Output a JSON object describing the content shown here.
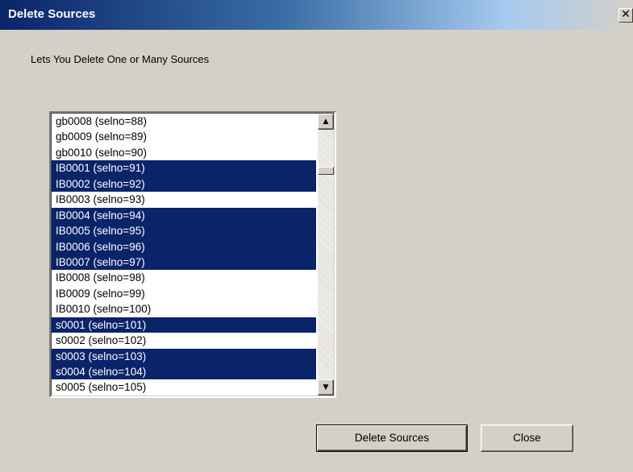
{
  "window": {
    "title": "Delete Sources",
    "close_glyph": "✕"
  },
  "description": "Lets You Delete One or Many Sources",
  "sources_list": {
    "items": [
      {
        "label": "gb0008 (selno=88)",
        "selected": false
      },
      {
        "label": "gb0009 (selno=89)",
        "selected": false
      },
      {
        "label": "gb0010 (selno=90)",
        "selected": false
      },
      {
        "label": "IB0001 (selno=91)",
        "selected": true
      },
      {
        "label": "IB0002 (selno=92)",
        "selected": true
      },
      {
        "label": "IB0003 (selno=93)",
        "selected": false
      },
      {
        "label": "IB0004 (selno=94)",
        "selected": true
      },
      {
        "label": "IB0005 (selno=95)",
        "selected": true
      },
      {
        "label": "IB0006 (selno=96)",
        "selected": true
      },
      {
        "label": "IB0007 (selno=97)",
        "selected": true
      },
      {
        "label": "IB0008 (selno=98)",
        "selected": false
      },
      {
        "label": "IB0009 (selno=99)",
        "selected": false
      },
      {
        "label": "IB0010 (selno=100)",
        "selected": false
      },
      {
        "label": "s0001 (selno=101)",
        "selected": true
      },
      {
        "label": "s0002 (selno=102)",
        "selected": false
      },
      {
        "label": "s0003 (selno=103)",
        "selected": true
      },
      {
        "label": "s0004 (selno=104)",
        "selected": true
      },
      {
        "label": "s0005 (selno=105)",
        "selected": false
      }
    ],
    "scroll_up_glyph": "▲",
    "scroll_down_glyph": "▼"
  },
  "buttons": {
    "delete_label": "Delete Sources",
    "close_label": "Close"
  },
  "colors": {
    "dialog_background": "#d4d0c8",
    "title_bar": "#0a246a",
    "selection": "#0a246a"
  }
}
